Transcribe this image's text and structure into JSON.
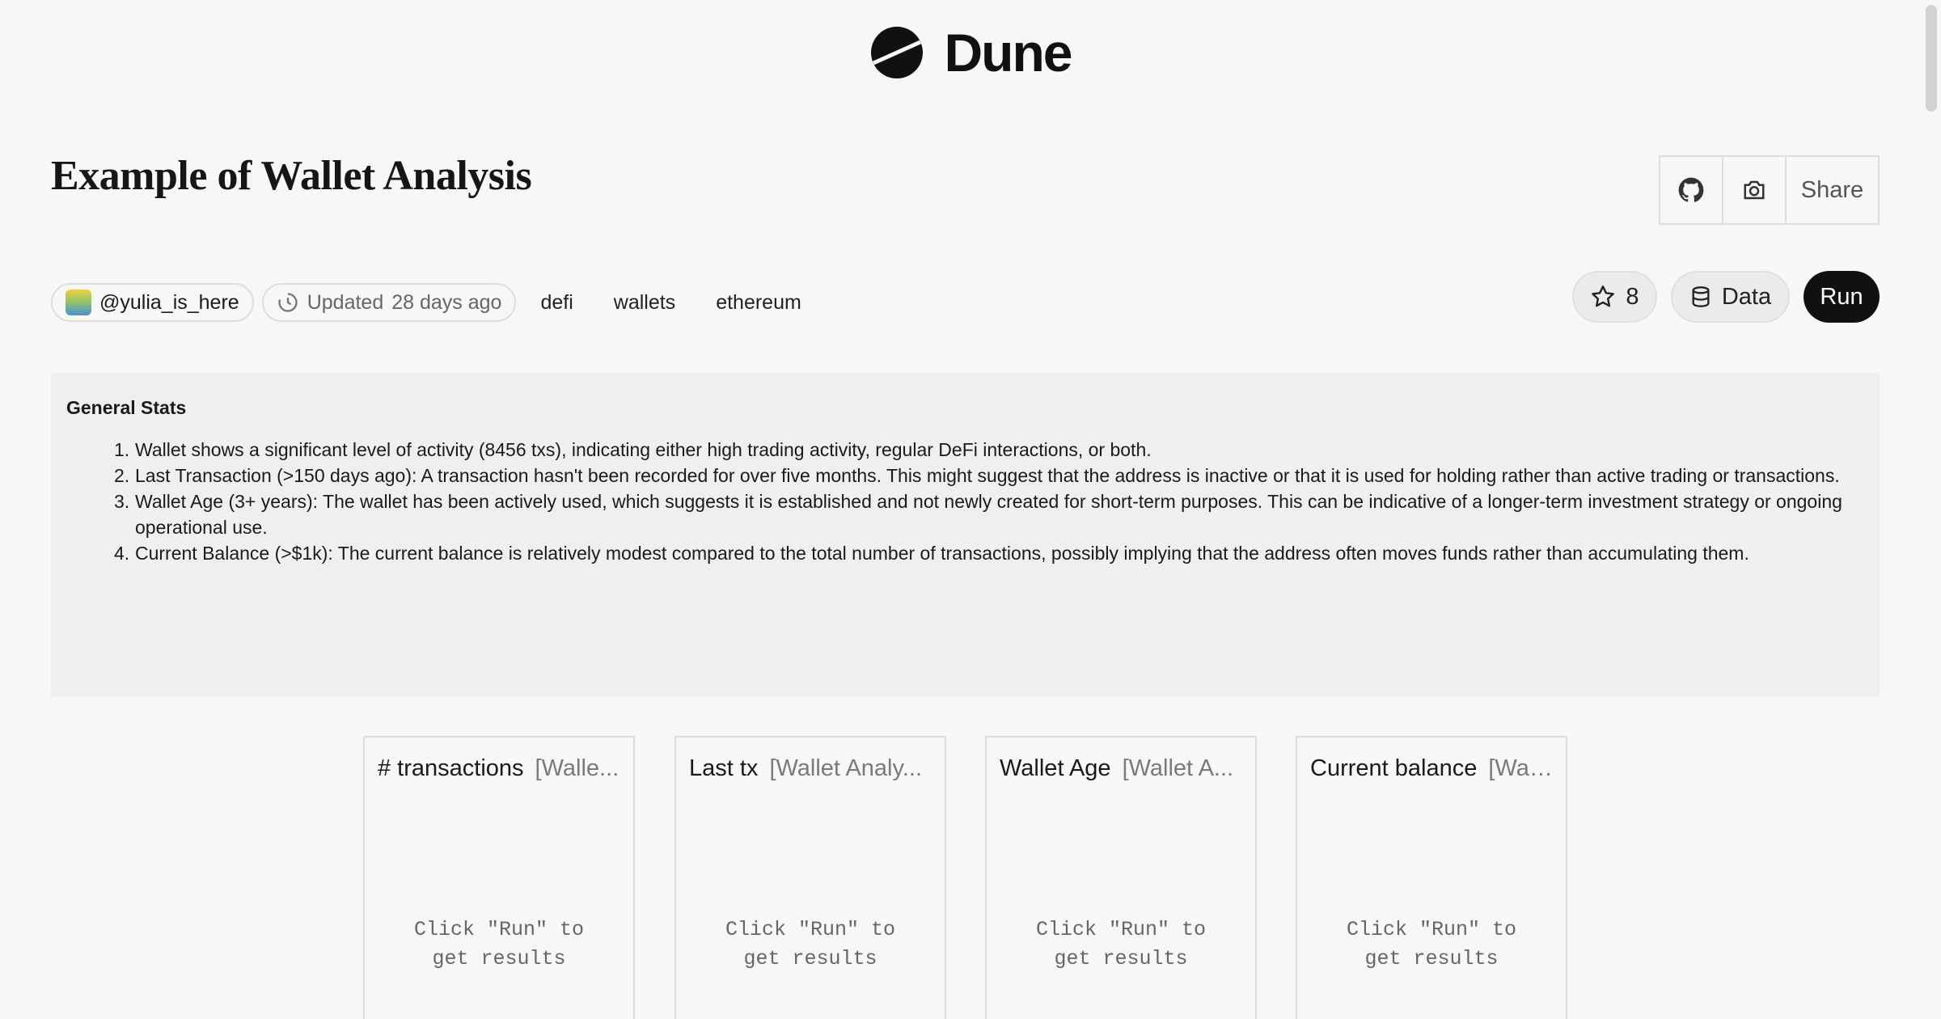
{
  "brand": {
    "name": "Dune"
  },
  "dashboard": {
    "title": "Example of Wallet Analysis",
    "actions": {
      "github_icon": "github-icon",
      "camera_icon": "camera-icon",
      "share_label": "Share"
    },
    "author": "@yulia_is_here",
    "updated_label": "Updated",
    "updated_value": "28 days ago",
    "tags": [
      "defi",
      "wallets",
      "ethereum"
    ],
    "star_count": "8",
    "data_label": "Data",
    "run_label": "Run"
  },
  "stats": {
    "title": "General Stats",
    "items": [
      {
        "num": "1.",
        "text": "Wallet shows a significant level of activity (8456 txs), indicating either high trading activity, regular DeFi interactions, or both."
      },
      {
        "num": "2.",
        "text": "Last Transaction (>150 days ago): A transaction hasn't been recorded for over five months. This might suggest that the address is inactive or that it is used for holding rather than active trading or transactions."
      },
      {
        "num": "3.",
        "text": "Wallet Age (3+ years): The wallet has been actively used, which suggests it is established and not newly created for short-term purposes. This can be indicative of a longer-term investment strategy or ongoing operational use."
      },
      {
        "num": "4.",
        "text": "Current Balance (>$1k): The current balance is relatively modest compared to the total number of transactions, possibly implying that the address often moves funds rather than accumulating them."
      }
    ]
  },
  "cards": [
    {
      "title": "# transactions",
      "query": "[Walle...",
      "message": "Click \"Run\" to get results"
    },
    {
      "title": "Last tx",
      "query": "[Wallet Analy...",
      "message": "Click \"Run\" to get results"
    },
    {
      "title": "Wallet Age",
      "query": "[Wallet A...",
      "message": "Click \"Run\" to get results"
    },
    {
      "title": "Current balance",
      "query": "[Wal...",
      "message": "Click \"Run\" to get results"
    }
  ]
}
